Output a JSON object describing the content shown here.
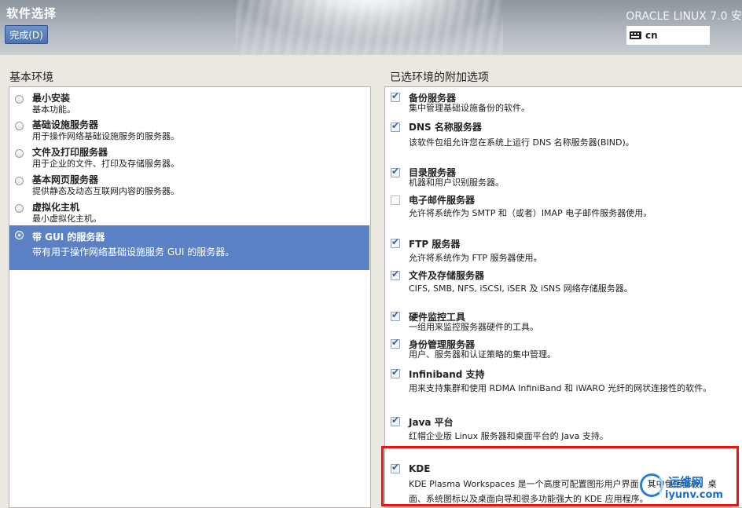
{
  "header": {
    "title": "软件选择",
    "done_label": "完成(D)",
    "product": "ORACLE LINUX 7.0 安",
    "keyboard_layout": "cn"
  },
  "base_env": {
    "title": "基本环境",
    "items": [
      {
        "name": "最小安装",
        "desc": "基本功能。",
        "selected": false
      },
      {
        "name": "基础设施服务器",
        "desc": "用于操作网络基础设施服务的服务器。",
        "selected": false
      },
      {
        "name": "文件及打印服务器",
        "desc": "用于企业的文件、打印及存储服务器。",
        "selected": false
      },
      {
        "name": "基本网页服务器",
        "desc": "提供静态及动态互联网内容的服务器。",
        "selected": false
      },
      {
        "name": "虚拟化主机",
        "desc": "最小虚拟化主机。",
        "selected": false
      },
      {
        "name": "带 GUI 的服务器",
        "desc": "带有用于操作网络基础设施服务 GUI 的服务器。",
        "selected": true
      }
    ]
  },
  "addons": {
    "title": "已选环境的附加选项",
    "items": [
      {
        "name": "备份服务器",
        "desc": "集中管理基础设施备份的软件。",
        "checked": true
      },
      {
        "name": "DNS 名称服务器",
        "desc": "该软件包组允许您在系统上运行 DNS 名称服务器(BIND)。",
        "checked": true
      },
      {
        "name": "目录服务器",
        "desc": "机器和用户识别服务器。",
        "checked": true
      },
      {
        "name": "电子邮件服务器",
        "desc": "允许将系统作为 SMTP 和（或者）IMAP 电子邮件服务器使用。",
        "checked": false
      },
      {
        "name": "FTP 服务器",
        "desc": "允许将系统作为 FTP 服务器使用。",
        "checked": true
      },
      {
        "name": "文件及存储服务器",
        "desc": "CIFS, SMB, NFS, iSCSI, iSER 及 iSNS 网络存储服务器。",
        "checked": true
      },
      {
        "name": "硬件监控工具",
        "desc": "一组用来监控服务器硬件的工具。",
        "checked": true
      },
      {
        "name": "身份管理服务器",
        "desc": "用户、服务器和认证策略的集中管理。",
        "checked": true
      },
      {
        "name": "Infiniband 支持",
        "desc": "用来支持集群和使用 RDMA InfiniBand 和 iWARO 光纤的网状连接性的软件。",
        "checked": true
      },
      {
        "name": "Java 平台",
        "desc": "红帽企业版 Linux 服务器和桌面平台的 Java 支持。",
        "checked": true
      },
      {
        "name": "KDE",
        "desc": " KDE Plasma Workspaces 是一个高度可配置图形用户界面，其中包括面板、桌面、系统图标以及桌面向导和很多功能强大的 KDE 应用程序。",
        "checked": true
      }
    ]
  },
  "watermark": {
    "line1": "运维网",
    "line2": "iyunv.com"
  },
  "colors": {
    "selection": "#5b80c3",
    "highlight_box": "#ee1111",
    "button": "#4b73ad"
  }
}
